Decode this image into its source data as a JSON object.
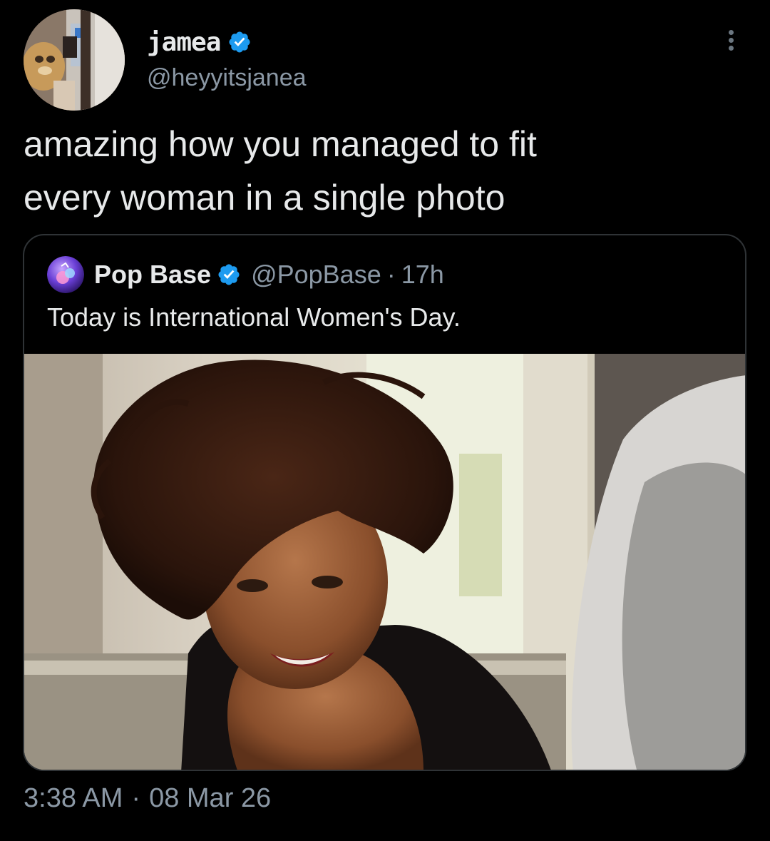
{
  "author": {
    "display_name": "jamea",
    "handle": "@heyyitsjanea",
    "verified": true,
    "avatar_icon": "profile-photo"
  },
  "tweet": {
    "text": "amazing how you managed to fit\nevery woman in a single photo"
  },
  "quoted_tweet": {
    "display_name": "Pop Base",
    "handle": "@PopBase",
    "separator": "·",
    "time_ago": "17h",
    "verified": true,
    "text": "Today is International Women's Day.",
    "media_icon": "portrait-photo"
  },
  "meta": {
    "time": "3:38 AM",
    "separator": "·",
    "date": "08 Mar 26"
  },
  "colors": {
    "background": "#000000",
    "primary_text": "#e7e9ea",
    "secondary_text": "#8b98a5",
    "verified_blue": "#1d9bf0",
    "border": "#2f3336"
  }
}
